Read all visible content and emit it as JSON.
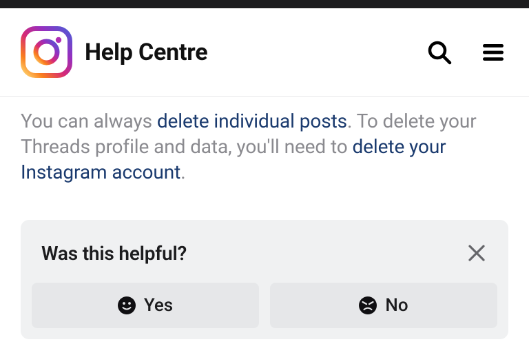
{
  "header": {
    "title": "Help Centre"
  },
  "body": {
    "text1": "You can always ",
    "link1": "delete individual posts",
    "text2": ". To delete your Threads profile and data, you'll need to ",
    "link2": "delete your Instagram account",
    "text3": "."
  },
  "feedback": {
    "title": "Was this helpful?",
    "yes_label": "Yes",
    "no_label": "No"
  }
}
